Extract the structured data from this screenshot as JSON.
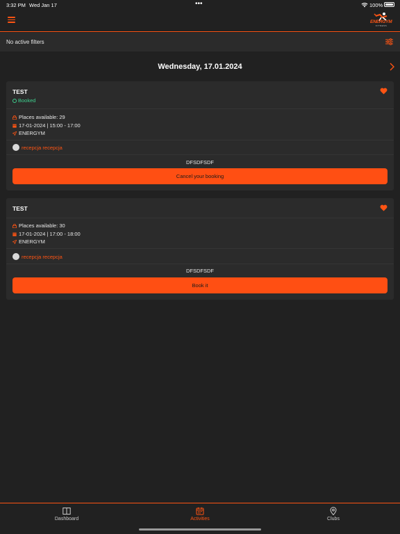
{
  "status_bar": {
    "time": "3:32 PM",
    "date": "Wed Jan 17",
    "battery": "100%"
  },
  "header": {
    "logo_text": "ENERGYM",
    "logo_subtext": "FITNESS",
    "accent_color": "#ff5413"
  },
  "filters": {
    "label": "No active filters"
  },
  "date_nav": {
    "title": "Wednesday, 17.01.2024"
  },
  "activities": [
    {
      "title": "TEST",
      "status": "Booked",
      "places": "Places available: 29",
      "datetime": "17-01-2024 | 15:00 - 17:00",
      "location": "ENERGYM",
      "trainer": "recepcja recepcja",
      "description": "DFSDFSDF",
      "action_label": "Cancel your booking"
    },
    {
      "title": "TEST",
      "status": "",
      "places": "Places available: 30",
      "datetime": "17-01-2024 | 17:00 - 18:00",
      "location": "ENERGYM",
      "trainer": "recepcja recepcja",
      "description": "DFSDFSDF",
      "action_label": "Book it"
    }
  ],
  "tab_bar": {
    "tabs": [
      {
        "label": "Dashboard",
        "icon": "book-icon",
        "active": false
      },
      {
        "label": "Activities",
        "icon": "calendar-icon",
        "active": true
      },
      {
        "label": "Clubs",
        "icon": "location-pin-icon",
        "active": false
      }
    ]
  },
  "colors": {
    "background": "#212121",
    "card": "#2b2b2b",
    "accent": "#ff5413",
    "booked": "#3fcf8e"
  }
}
